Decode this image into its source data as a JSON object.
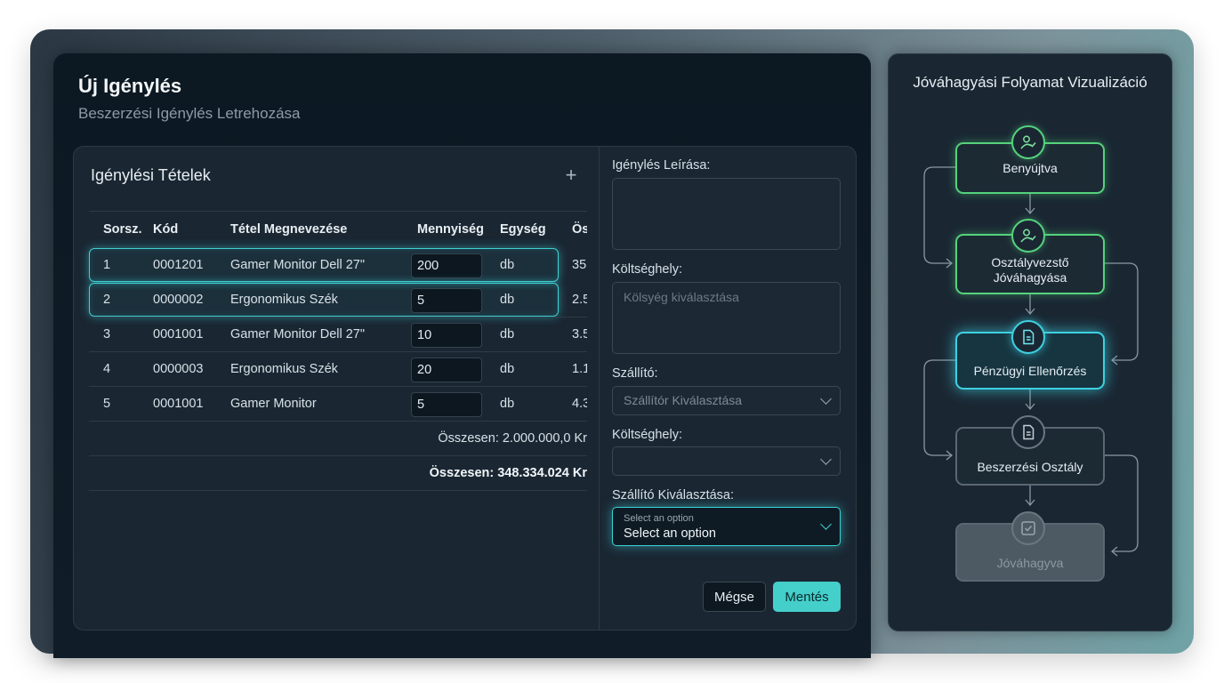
{
  "header": {
    "title": "Új Igénylés",
    "subtitle": "Beszerzési Igénylés Letrehozása"
  },
  "items": {
    "title": "Igénylési Tételek",
    "add_icon": "plus-icon",
    "columns": [
      "Sorsz.",
      "Kód",
      "Tétel Megnevezése",
      "Mennyiség",
      "Egység",
      "Ös"
    ],
    "rows": [
      {
        "num": "1",
        "code": "0001201",
        "name": "Gamer Monitor Dell 27\"",
        "qty": "200",
        "unit": "db",
        "total": "35"
      },
      {
        "num": "2",
        "code": "0000002",
        "name": "Ergonomikus Szék",
        "qty": "5",
        "unit": "db",
        "total": "2.5"
      },
      {
        "num": "3",
        "code": "0001001",
        "name": "Gamer Monitor Dell 27\"",
        "qty": "10",
        "unit": "db",
        "total": "3.5"
      },
      {
        "num": "4",
        "code": "0000003",
        "name": "Ergonomikus Szék",
        "qty": "20",
        "unit": "db",
        "total": "1.1"
      },
      {
        "num": "5",
        "code": "0001001",
        "name": "Gamer Monitor",
        "qty": "5",
        "unit": "db",
        "total": "4.3"
      }
    ],
    "subtotal": "Összesen: 2.000.000,0 Kr",
    "total": "Összesen: 348.334.024 Kr"
  },
  "form": {
    "description_label": "Igénylés Leírása:",
    "description_value": "",
    "cost_center_label": "Költséghely:",
    "cost_center_placeholder": "Kölsyég kiválasztása",
    "supplier_label": "Szállító:",
    "supplier_placeholder": "Szállítór Kiválasztása",
    "cost_center2_label": "Költséghely:",
    "cost_center2_value": "",
    "supplier_select_label": "Szállító Kiválasztása:",
    "supplier_select_hint": "Select an option",
    "supplier_select_value": "Select an option",
    "cancel_label": "Mégse",
    "save_label": "Mentés"
  },
  "flow": {
    "title": "Jóváhagyási Folyamat Vizualizáció",
    "steps": [
      {
        "label": "Benyújtva",
        "status": "done",
        "icon": "user-check-icon"
      },
      {
        "label": "Osztályvezstő Jóváhagyása",
        "status": "done",
        "icon": "user-check-icon"
      },
      {
        "label": "Pénzügyi Ellenőrzés",
        "status": "active",
        "icon": "document-icon"
      },
      {
        "label": "Beszerzési Osztály",
        "status": "pending",
        "icon": "document-icon"
      },
      {
        "label": "Jóváhagyva",
        "status": "disabled",
        "icon": "checkbox-icon"
      }
    ]
  },
  "colors": {
    "accent": "#3fd0d4",
    "done": "#55d27c",
    "active": "#3fd0e0",
    "save_button": "#44cfcb",
    "panel": "#1a2733",
    "background": "#0c1822"
  }
}
